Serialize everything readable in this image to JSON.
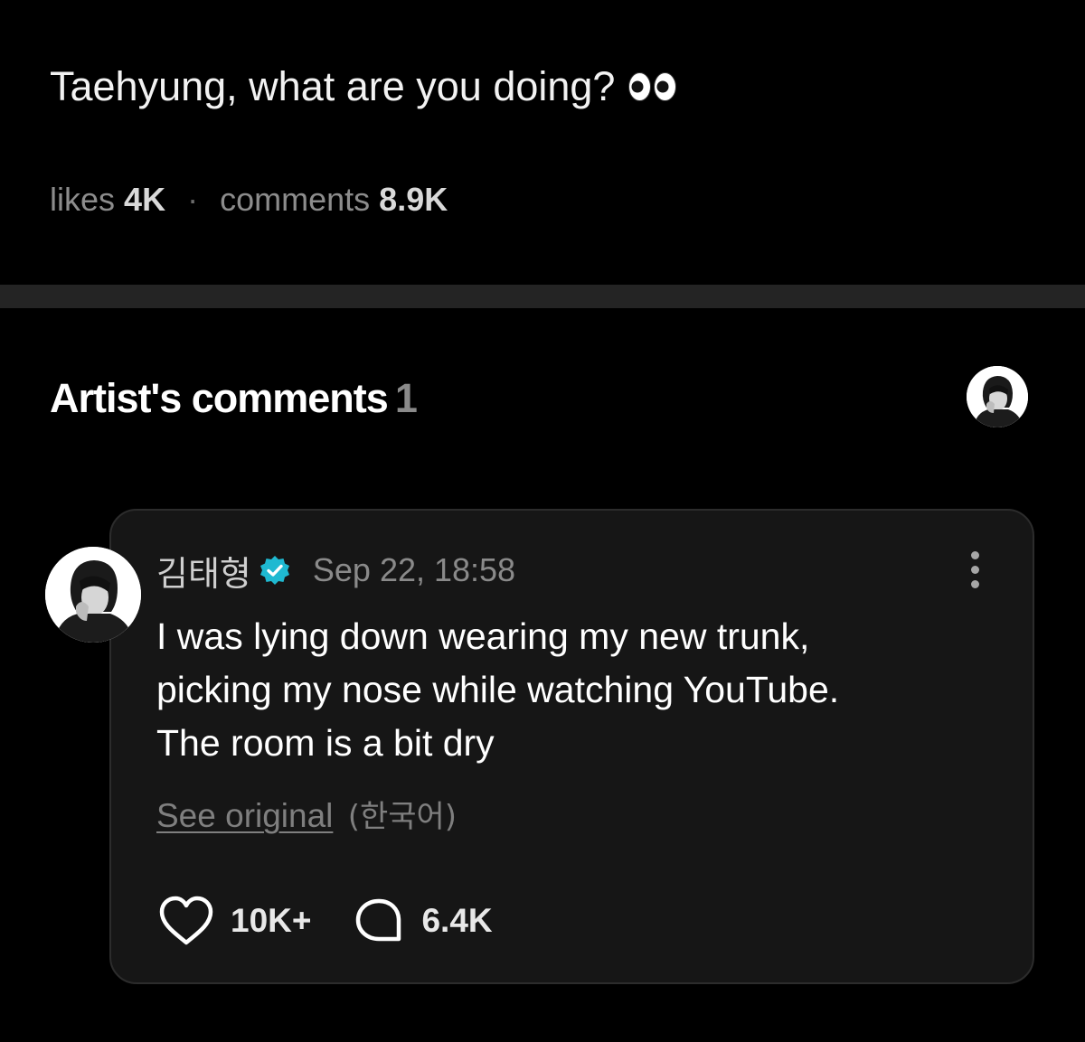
{
  "post": {
    "text": "Taehyung, what are you doing?",
    "emoji_name": "eyes-emoji"
  },
  "stats": {
    "likes_label": "likes",
    "likes_value": "4K",
    "separator": "·",
    "comments_label": "comments",
    "comments_value": "8.9K"
  },
  "artist_comments": {
    "title": "Artist's comments",
    "count": "1",
    "header_avatar_icon": "artist-avatar"
  },
  "comment": {
    "author": "김태형",
    "verified_icon": "verified-badge-icon",
    "timestamp": "Sep 22, 18:58",
    "body_lines": [
      "I was lying down wearing my new trunk,",
      "picking my nose while watching YouTube.",
      "The room is a bit dry"
    ],
    "see_original": "See original",
    "original_language": "(한국어)",
    "like_count": "10K+",
    "reply_count": "6.4K"
  },
  "colors": {
    "background": "#000000",
    "card": "#161616",
    "divider": "#242424",
    "verified": "#1fb9d1",
    "muted_text": "#8a8a8a"
  }
}
